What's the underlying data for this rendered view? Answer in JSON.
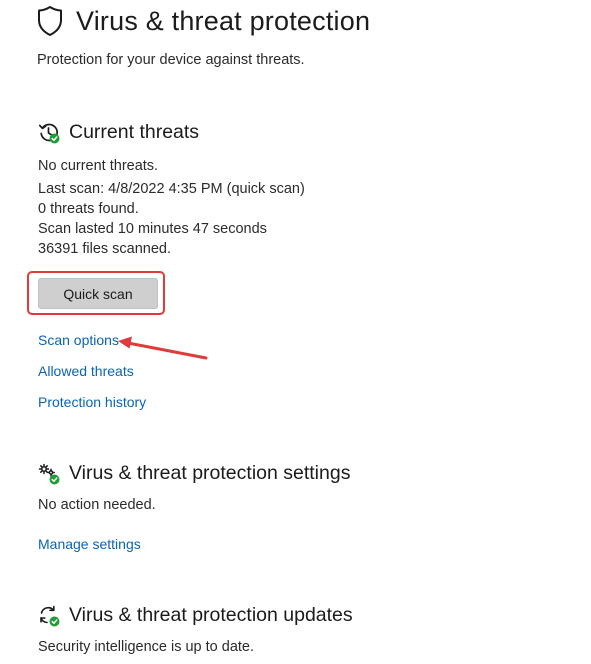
{
  "header": {
    "title": "Virus & threat protection",
    "subtitle": "Protection for your device against threats.",
    "icon": "shield-icon"
  },
  "current_threats": {
    "title": "Current threats",
    "icon": "threat-history-icon",
    "status": "No current threats.",
    "last_scan": "Last scan: 4/8/2022 4:35 PM (quick scan)",
    "threats_found": "0 threats found.",
    "scan_duration": "Scan lasted 10 minutes 47 seconds",
    "files_scanned": "36391 files scanned.",
    "quick_scan_label": "Quick scan",
    "links": {
      "scan_options": "Scan options",
      "allowed_threats": "Allowed threats",
      "protection_history": "Protection history"
    }
  },
  "settings": {
    "title": "Virus & threat protection settings",
    "icon": "settings-gear-check-icon",
    "status": "No action needed.",
    "manage_link": "Manage settings"
  },
  "updates": {
    "title": "Virus & threat protection updates",
    "icon": "update-refresh-check-icon",
    "status": "Security intelligence is up to date."
  },
  "colors": {
    "link": "#0a64b4",
    "highlight": "#de3b3b",
    "check_green": "#1f9d3a",
    "button_bg": "#cfcfcf"
  }
}
